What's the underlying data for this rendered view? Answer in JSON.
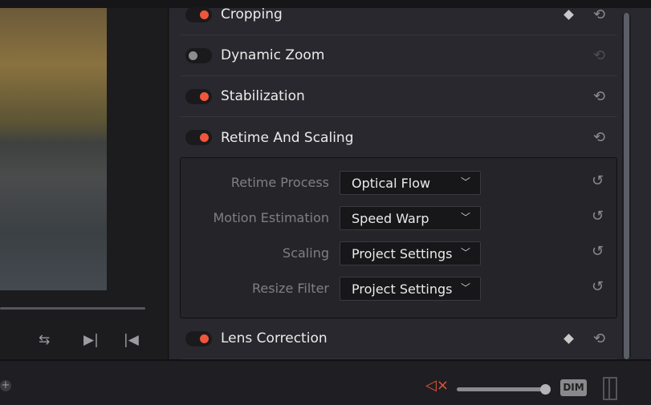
{
  "viewer": {
    "controls": [
      "loop-icon",
      "next-frame-icon",
      "prev-frame-icon"
    ]
  },
  "inspector": {
    "sections": [
      {
        "label": "Cropping",
        "enabled": true,
        "keyframe": true
      },
      {
        "label": "Dynamic Zoom",
        "enabled": false,
        "keyframe": false
      },
      {
        "label": "Stabilization",
        "enabled": true,
        "keyframe": false
      },
      {
        "label": "Retime And Scaling",
        "enabled": true,
        "keyframe": false
      },
      {
        "label": "Lens Correction",
        "enabled": true,
        "keyframe": true
      }
    ],
    "retime": [
      {
        "label": "Retime Process",
        "value": "Optical Flow"
      },
      {
        "label": "Motion Estimation",
        "value": "Speed Warp"
      },
      {
        "label": "Scaling",
        "value": "Project Settings"
      },
      {
        "label": "Resize Filter",
        "value": "Project Settings"
      }
    ]
  },
  "bottom": {
    "dim_label": "DIM",
    "volume": 1.0,
    "muted": true,
    "accent": "#f0563c"
  }
}
